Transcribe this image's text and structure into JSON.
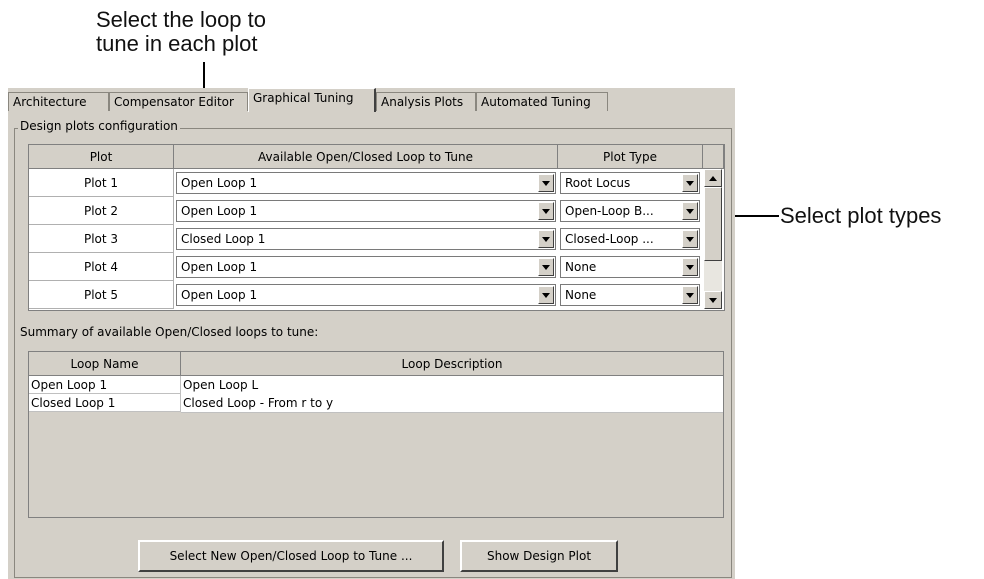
{
  "callouts": {
    "loop_line1": "Select the loop to",
    "loop_line2": "tune in each plot",
    "plot_types": "Select plot types"
  },
  "tabs": [
    "Architecture",
    "Compensator Editor",
    "Graphical Tuning",
    "Analysis Plots",
    "Automated Tuning"
  ],
  "active_tab": "Graphical Tuning",
  "group_title": "Design plots configuration",
  "plot_table": {
    "headers": [
      "Plot",
      "Available Open/Closed Loop to Tune",
      "Plot Type"
    ],
    "rows": [
      {
        "plot": "Plot 1",
        "loop": "Open Loop 1",
        "type": "Root Locus"
      },
      {
        "plot": "Plot 2",
        "loop": "Open Loop 1",
        "type": "Open-Loop B..."
      },
      {
        "plot": "Plot 3",
        "loop": "Closed Loop 1",
        "type": "Closed-Loop ..."
      },
      {
        "plot": "Plot 4",
        "loop": "Open Loop 1",
        "type": "None"
      },
      {
        "plot": "Plot 5",
        "loop": "Open Loop 1",
        "type": "None"
      }
    ]
  },
  "summary_label": "Summary of available Open/Closed loops to tune:",
  "summary_table": {
    "headers": [
      "Loop Name",
      "Loop Description"
    ],
    "rows": [
      {
        "name": "Open Loop 1",
        "description": "Open Loop L"
      },
      {
        "name": "Closed Loop 1",
        "description": "Closed Loop - From r to y"
      }
    ]
  },
  "buttons": {
    "select_new": "Select New Open/Closed Loop to Tune ...",
    "show_design": "Show Design Plot"
  }
}
